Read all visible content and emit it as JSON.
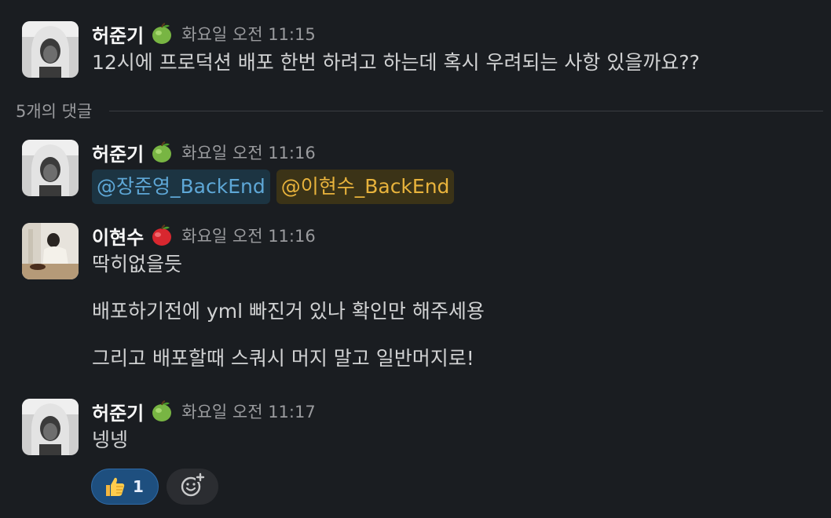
{
  "thread": {
    "reply_count_label": "5개의 댓글"
  },
  "messages": [
    {
      "author": "허준기",
      "status_emoji": "green-apple",
      "timestamp": "화요일 오전 11:15",
      "text": "12시에 프로덕션 배포 한번 하려고 하는데 혹시 우려되는 사항 있을까요??"
    },
    {
      "author": "허준기",
      "status_emoji": "green-apple",
      "timestamp": "화요일 오전 11:16",
      "mentions": [
        "@장준영_BackEnd",
        "@이현수_BackEnd"
      ]
    },
    {
      "author": "이현수",
      "status_emoji": "red-apple",
      "timestamp": "화요일 오전 11:16",
      "lines": [
        "딱히없을듯",
        "배포하기전에 yml 빠진거 있나 확인만 해주세용",
        "그리고 배포할때 스쿼시 머지 말고 일반머지로!"
      ]
    },
    {
      "author": "허준기",
      "status_emoji": "green-apple",
      "timestamp": "화요일 오전 11:17",
      "text": "넹넹",
      "reactions": [
        {
          "emoji": "thumbs-up",
          "count": "1"
        }
      ]
    }
  ],
  "colors": {
    "background": "#1a1d21",
    "mention_blue_bg": "#1c3442",
    "mention_blue_text": "#5ea7d6",
    "mention_yellow_bg": "#3b3317",
    "mention_yellow_text": "#e8b33c",
    "reaction_active_bg": "#1e4f7f"
  }
}
